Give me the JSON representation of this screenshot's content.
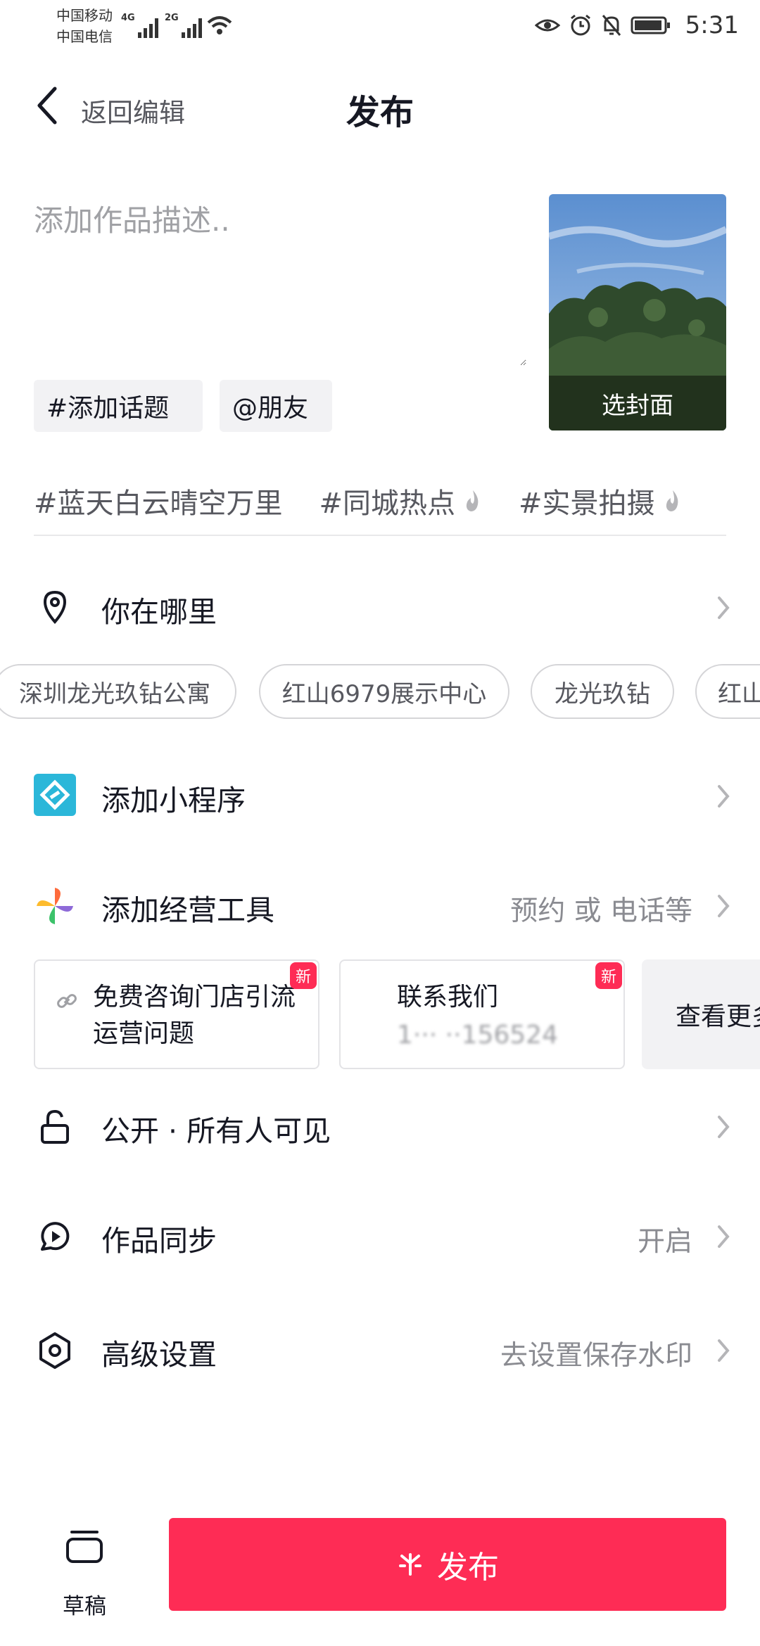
{
  "status_bar": {
    "carrier1": "中国移动",
    "carrier2": "中国电信",
    "net1": "4G",
    "net2": "2G",
    "time": "5:31"
  },
  "header": {
    "back_label": "返回编辑",
    "title": "发布"
  },
  "description": {
    "placeholder": "添加作品描述.."
  },
  "tags": {
    "topic": "#添加话题",
    "friend": "@朋友"
  },
  "cover": {
    "label": "选封面"
  },
  "suggested_topics": [
    "#蓝天白云晴空万里",
    "#同城热点",
    "#实景拍摄"
  ],
  "location": {
    "label": "你在哪里",
    "chips": [
      "深圳龙光玖钻公寓",
      "红山6979展示中心",
      "龙光玖钻",
      "红山"
    ]
  },
  "mini_program": {
    "label": "添加小程序"
  },
  "business_tools": {
    "label": "添加经营工具",
    "value": "预约 或 电话等",
    "cards": [
      {
        "text": "免费咨询门店引流运营问题",
        "badge": "新"
      },
      {
        "text": "联系我们",
        "subtext": "1··· ··156524",
        "badge": "新"
      }
    ],
    "more": "查看更多"
  },
  "visibility": {
    "label": "公开 · 所有人可见"
  },
  "sync": {
    "label": "作品同步",
    "value": "开启"
  },
  "advanced": {
    "label": "高级设置",
    "value": "去设置保存水印"
  },
  "bottom": {
    "draft_label": "草稿",
    "publish_label": "发布"
  },
  "colors": {
    "primary": "#fe2c55",
    "text": "#161823",
    "secondary_text": "#8a8b91"
  }
}
